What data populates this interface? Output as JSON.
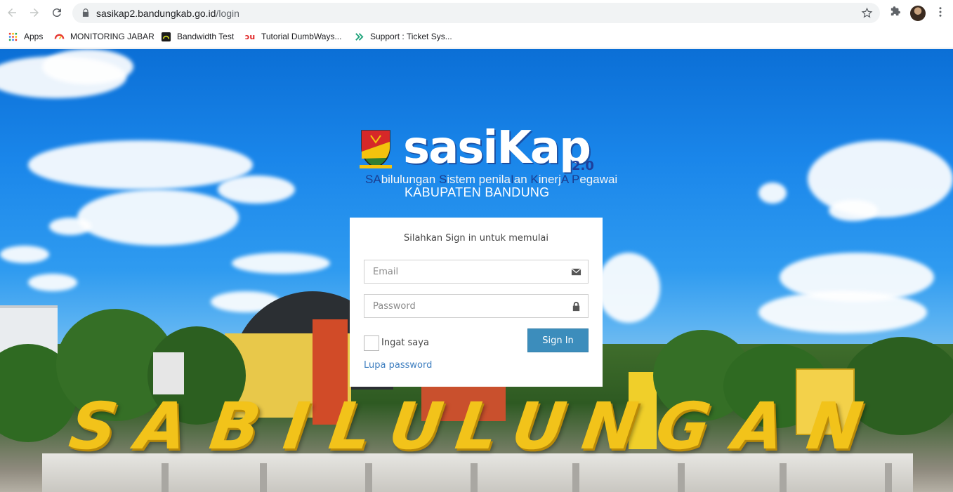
{
  "browser": {
    "url_host": "sasikap2.bandungkab.go.id",
    "url_path": "/login",
    "bookmarks": [
      {
        "label": "Apps",
        "icon": "apps-grid-icon"
      },
      {
        "label": "MONITORING JABAR",
        "icon": "gauge-icon"
      },
      {
        "label": "Bandwidth Test",
        "icon": "speedtest-icon"
      },
      {
        "label": "Tutorial DumbWays...",
        "icon": "dumbways-icon"
      },
      {
        "label": "Support : Ticket Sys...",
        "icon": "support-icon"
      }
    ]
  },
  "logo": {
    "title": "sasiKap",
    "version": "2.0",
    "subtitle_parts": [
      "SA",
      "bilulungan ",
      "S",
      "istem penila",
      "I",
      "an ",
      "K",
      "inerj",
      "A",
      " ",
      "P",
      "egawai"
    ],
    "region": "KABUPATEN BANDUNG"
  },
  "login": {
    "message": "Silahkan Sign in untuk memulai",
    "email_placeholder": "Email",
    "email_value": "",
    "password_placeholder": "Password",
    "password_value": "",
    "remember_label": "Ingat saya",
    "remember_checked": false,
    "signin_label": "Sign In",
    "forgot_label": "Lupa password"
  },
  "background": {
    "monument_letters": [
      "S",
      "A",
      "B",
      "I",
      "L",
      "U",
      "L",
      "U",
      "N",
      "G",
      "A",
      "N"
    ]
  },
  "colors": {
    "primary_button": "#3c8dbc",
    "link": "#3c7dbf",
    "monument_yellow": "#f2c31a"
  }
}
